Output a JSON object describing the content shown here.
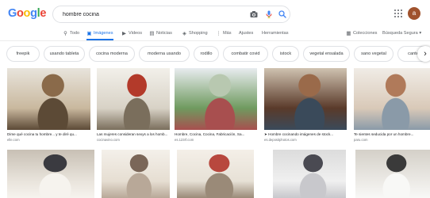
{
  "header": {
    "logo_letters": [
      {
        "ch": "G",
        "color": "#4285f4"
      },
      {
        "ch": "o",
        "color": "#ea4335"
      },
      {
        "ch": "o",
        "color": "#fbbc05"
      },
      {
        "ch": "g",
        "color": "#4285f4"
      },
      {
        "ch": "l",
        "color": "#34a853"
      },
      {
        "ch": "e",
        "color": "#ea4335"
      }
    ],
    "search_value": "hombre cocina",
    "avatar_letter": "a"
  },
  "nav": {
    "tabs": [
      {
        "label": "Todo",
        "icon": "search-icon",
        "glyph": "⚲"
      },
      {
        "label": "Imágenes",
        "icon": "image-icon",
        "glyph": "▣",
        "active": true
      },
      {
        "label": "Videos",
        "icon": "video-icon",
        "glyph": "▶"
      },
      {
        "label": "Noticias",
        "icon": "news-icon",
        "glyph": "▤"
      },
      {
        "label": "Shopping",
        "icon": "tag-icon",
        "glyph": "◈"
      },
      {
        "label": "Más",
        "icon": "more-icon",
        "glyph": "⋮"
      },
      {
        "label": "Ajustes"
      },
      {
        "label": "Herramientas"
      }
    ],
    "right": {
      "collections": "Colecciones",
      "safe_search": "Búsqueda Segura",
      "safe_search_arrow": "▾"
    }
  },
  "chips": [
    "freepik",
    "usando tableta",
    "cocina moderna",
    "moderna usando",
    "rodillo",
    "combatir covid",
    "istock",
    "vegetal ensalada",
    "sano vegetal",
    "cantera"
  ],
  "results": [
    {
      "caption": "Dime qué cocina tu hombre... y te diré qu...",
      "source": "elle.com",
      "colors": [
        "#c9b89e",
        "#8a6a4a",
        "#e8e4dc",
        "#5c4a36"
      ]
    },
    {
      "caption": "Las mujeres consideran sexys a los homb...",
      "source": "cocinavino.com",
      "colors": [
        "#d8d2c6",
        "#b33a2a",
        "#f2f0ea",
        "#7a6e5c"
      ]
    },
    {
      "caption": "Hombre, Cocina, Cocina, Fabricación, Sa...",
      "source": "es.123rf.com",
      "colors": [
        "#6f9a5f",
        "#b8c8b0",
        "#e8ecef",
        "#a84f4f"
      ]
    },
    {
      "caption": "➤ Hombre cocinando imágenes de stock...",
      "source": "es.depositphotos.com",
      "colors": [
        "#5a3a2a",
        "#9a6a4a",
        "#cfc2b0",
        "#3a4a5a"
      ]
    },
    {
      "caption": "Te sientes seducida por un hombre...",
      "source": "paru.com",
      "colors": [
        "#d9c9b8",
        "#b07a5a",
        "#f0ece6",
        "#8a9aa8"
      ]
    },
    {
      "caption": "",
      "source": "",
      "colors": [
        "#e9e4dc",
        "#3a3a40",
        "#c8c0b4",
        "#f6f3ee"
      ]
    },
    {
      "caption": "",
      "source": "",
      "colors": [
        "#e6ded2",
        "#7a6658",
        "#f4f0ea",
        "#b8a898"
      ]
    },
    {
      "caption": "",
      "source": "",
      "colors": [
        "#e7e1d6",
        "#b8483e",
        "#f4efe8",
        "#9a8a78"
      ]
    },
    {
      "caption": "",
      "source": "",
      "colors": [
        "#f0f0f0",
        "#4a4a52",
        "#dcdcdc",
        "#c8c8cc"
      ]
    },
    {
      "caption": "",
      "source": "",
      "colors": [
        "#eceae6",
        "#3a3a3a",
        "#d4d0c8",
        "#f8f8f6"
      ]
    }
  ]
}
